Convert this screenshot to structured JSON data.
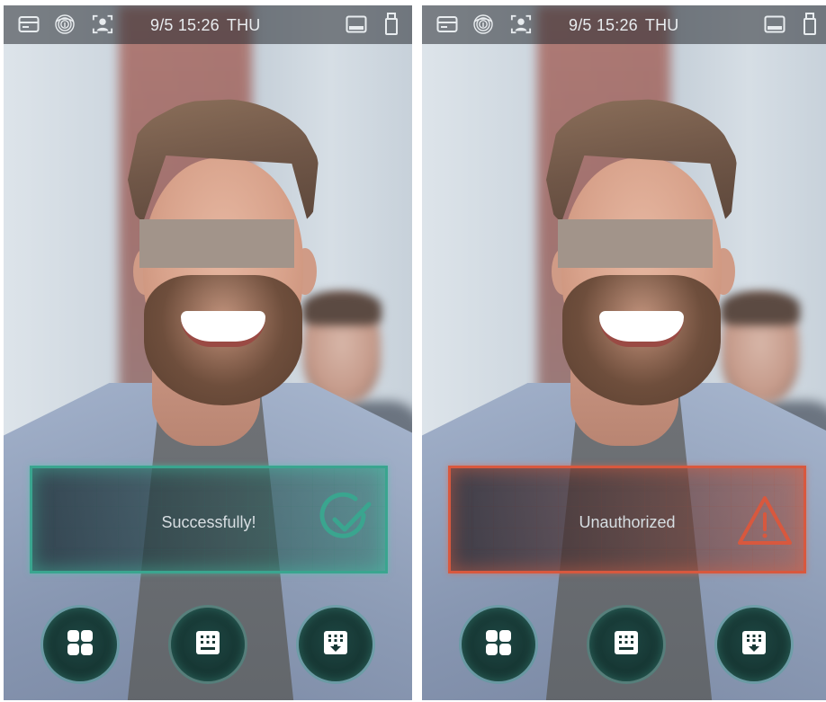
{
  "screens": [
    {
      "id": "left",
      "status_bar": {
        "date_time": "9/5 15:26",
        "weekday": "THU",
        "icons": [
          "card-icon",
          "fingerprint-icon",
          "face-icon",
          "network-icon",
          "usb-icon"
        ]
      },
      "message": {
        "text": "Successfully!",
        "state": "success",
        "icon": "checkmark-icon",
        "accent_color": "#3aa58f"
      },
      "buttons": [
        "menu-icon",
        "keypad-icon",
        "verify-keypad-icon"
      ]
    },
    {
      "id": "right",
      "status_bar": {
        "date_time": "9/5 15:26",
        "weekday": "THU",
        "icons": [
          "card-icon",
          "fingerprint-icon",
          "face-icon",
          "network-icon",
          "usb-icon"
        ]
      },
      "message": {
        "text": "Unauthorized",
        "state": "error",
        "icon": "warning-icon",
        "accent_color": "#d8583e"
      },
      "buttons": [
        "menu-icon",
        "keypad-icon",
        "verify-keypad-icon"
      ]
    }
  ],
  "colors": {
    "status_text": "#e8ecef",
    "button_bg": "#173734",
    "button_icon": "#ffffff"
  }
}
